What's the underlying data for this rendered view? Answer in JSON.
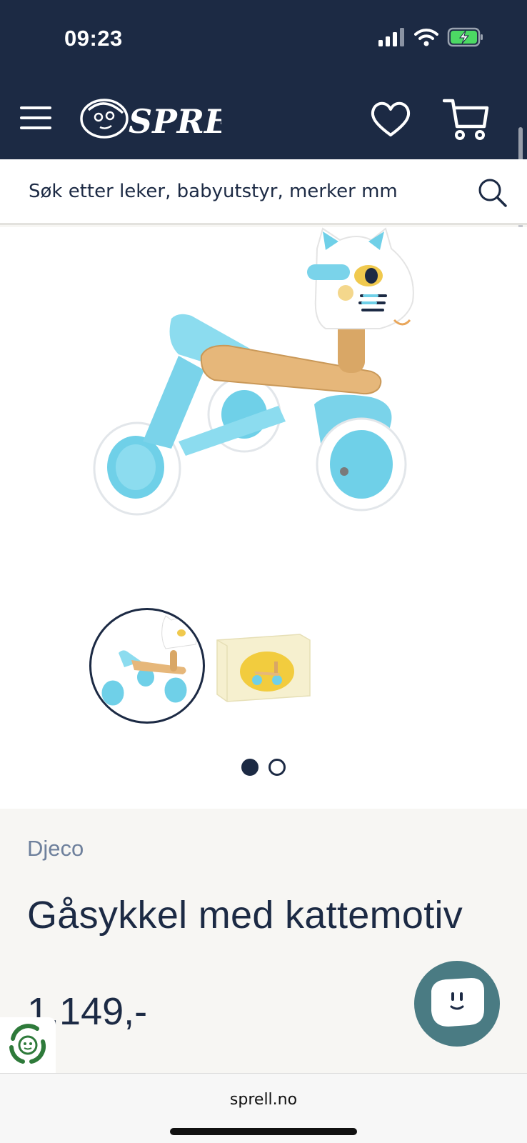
{
  "status_bar": {
    "time": "09:23"
  },
  "header": {
    "logo_text": "SPRELL"
  },
  "search": {
    "placeholder": "Søk etter leker, babyutstyr, merker mm"
  },
  "product": {
    "brand": "Djeco",
    "title": "Gåsykkel med kattemotiv",
    "price": "1.149,-"
  },
  "gallery": {
    "active_index": 1,
    "image_count": 2
  },
  "browser": {
    "url": "sprell.no"
  },
  "colors": {
    "navy": "#1c2a44",
    "accent_blue": "#6fd0e8",
    "chat_teal": "#4a7b83"
  }
}
